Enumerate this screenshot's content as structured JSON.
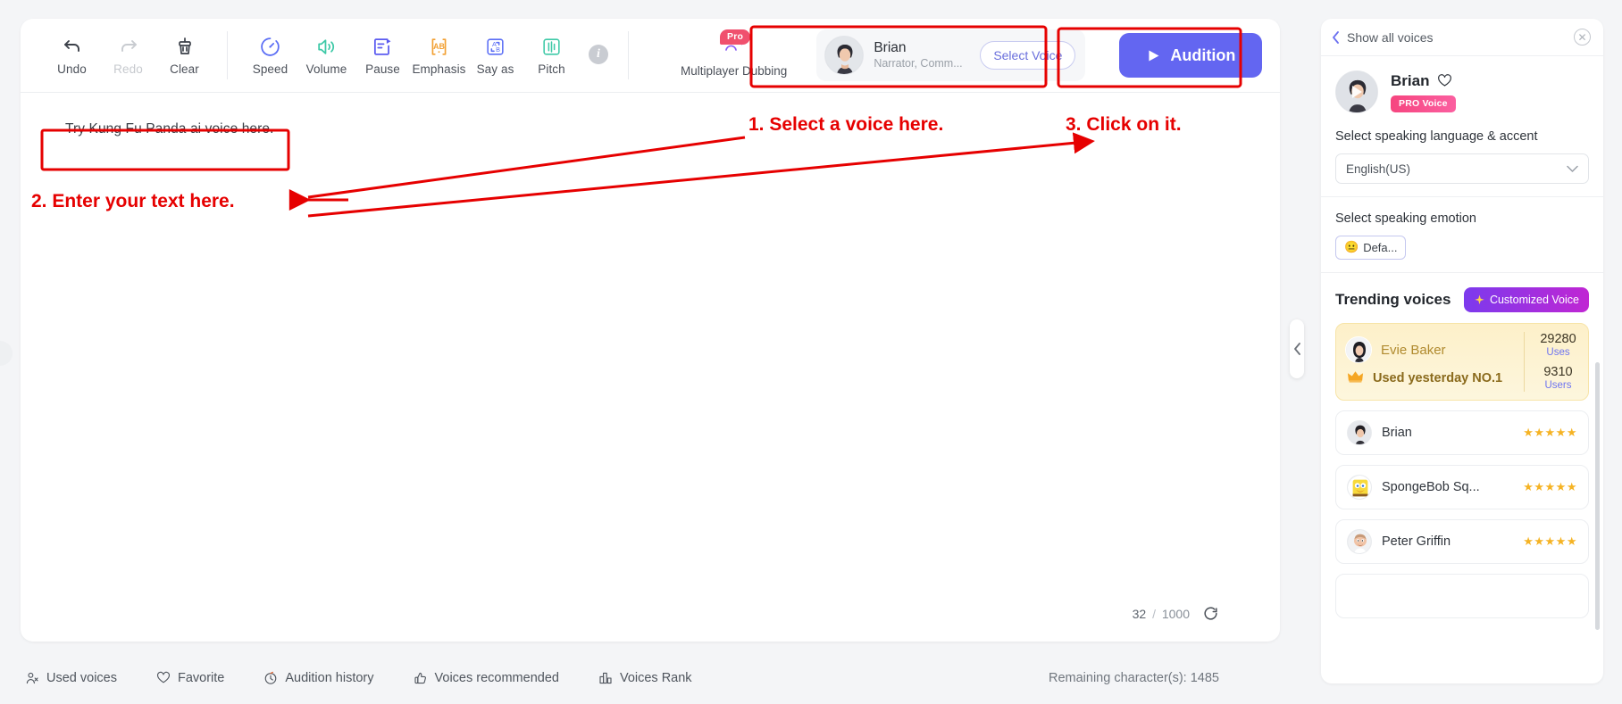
{
  "toolbar": {
    "groups": [
      {
        "items": [
          {
            "label": "Undo",
            "icon": "undo-icon",
            "disabled": false
          },
          {
            "label": "Redo",
            "icon": "redo-icon",
            "disabled": true
          },
          {
            "label": "Clear",
            "icon": "clear-brush-icon",
            "disabled": false
          }
        ]
      },
      {
        "items": [
          {
            "label": "Speed",
            "icon": "speed-gauge-icon",
            "disabled": false
          },
          {
            "label": "Volume",
            "icon": "volume-icon",
            "disabled": false
          },
          {
            "label": "Pause",
            "icon": "pause-insert-icon",
            "disabled": false
          },
          {
            "label": "Emphasis",
            "icon": "emphasis-ab-icon",
            "disabled": false
          },
          {
            "label": "Say as",
            "icon": "say-as-icon",
            "disabled": false
          },
          {
            "label": "Pitch",
            "icon": "pitch-bars-icon",
            "disabled": false
          }
        ]
      }
    ],
    "info_icon": "info-icon",
    "multiplayer_dubbing": {
      "label": "Multiplayer Dubbing",
      "badge": "Pro",
      "icon": "multiplayer-dubbing-icon"
    }
  },
  "voice_selector": {
    "name": "Brian",
    "description": "Narrator, Comm...",
    "select_button": "Select Voice",
    "avatar": "brian-avatar"
  },
  "audition": {
    "label": "Audition",
    "icon": "play-icon",
    "color": "#6366f1"
  },
  "editor": {
    "text": "Try Kung Fu Panda ai voice here.",
    "char_used": "32",
    "char_sep": "/",
    "char_max": "1000",
    "refresh_icon": "refresh-icon"
  },
  "bottom_bar": {
    "items": [
      {
        "label": "Used voices",
        "icon": "used-voices-icon"
      },
      {
        "label": "Favorite",
        "icon": "heart-icon"
      },
      {
        "label": "Audition history",
        "icon": "clock-history-icon"
      },
      {
        "label": "Voices recommended",
        "icon": "thumbs-up-icon"
      },
      {
        "label": "Voices Rank",
        "icon": "rank-bars-icon"
      }
    ],
    "remaining": "Remaining character(s): 1485"
  },
  "collapse_handle": {
    "icon": "chevron-left-icon"
  },
  "right_panel": {
    "header": {
      "back_label": "Show all voices",
      "back_icon": "chevron-left-icon",
      "close_icon": "close-icon"
    },
    "voice": {
      "name": "Brian",
      "favorite_icon": "heart-outline-icon",
      "badge": "PRO Voice",
      "avatar": "brian-avatar",
      "play_icon": "play-icon"
    },
    "language_section": {
      "label": "Select speaking language & accent",
      "value": "English(US)",
      "chevron_icon": "chevron-down-icon"
    },
    "emotion_section": {
      "label": "Select speaking emotion",
      "chip": {
        "emoji": "😐",
        "label": "Defa..."
      }
    },
    "trending": {
      "title": "Trending voices",
      "customized_button": {
        "label": "Customized Voice",
        "icon": "sparkle-icon"
      },
      "top_card": {
        "name": "Evie Baker",
        "subtitle": "Used yesterday NO.1",
        "crown_icon": "crown-icon",
        "avatar": "evie-baker-avatar",
        "stats": [
          {
            "number": "29280",
            "label": "Uses"
          },
          {
            "number": "9310",
            "label": "Users"
          }
        ]
      },
      "voices": [
        {
          "name": "Brian",
          "stars": "★★★★★",
          "avatar": "brian-avatar"
        },
        {
          "name": "SpongeBob Sq...",
          "stars": "★★★★★",
          "avatar": "spongebob-avatar"
        },
        {
          "name": "Peter Griffin",
          "stars": "★★★★★",
          "avatar": "peter-griffin-avatar"
        }
      ]
    }
  },
  "annotations": [
    {
      "id": "a1",
      "text": "1. Select a voice here."
    },
    {
      "id": "a2",
      "text": "2. Enter your text here."
    },
    {
      "id": "a3",
      "text": "3. Click on it."
    }
  ]
}
